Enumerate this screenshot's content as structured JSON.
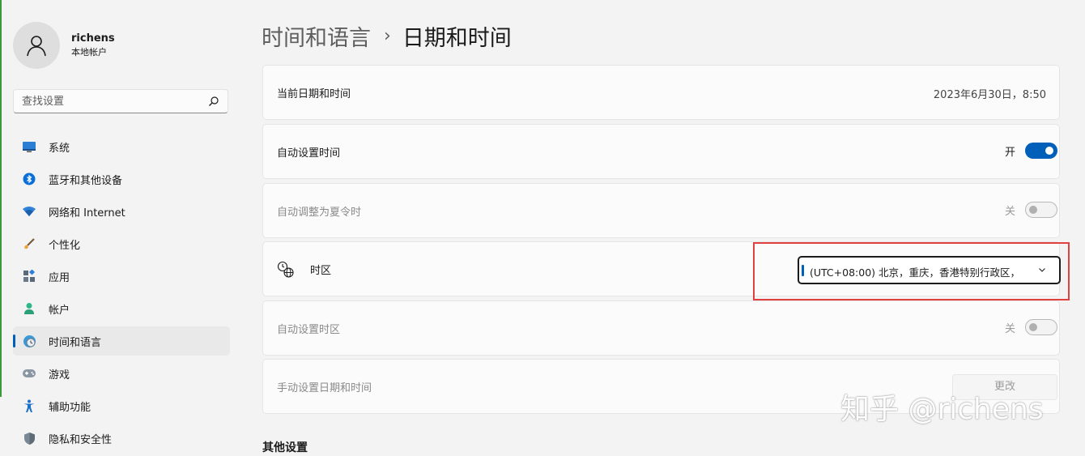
{
  "profile": {
    "name": "richens",
    "account_type": "本地帐户"
  },
  "search": {
    "placeholder": "查找设置"
  },
  "nav": {
    "items": [
      {
        "label": "系统",
        "icon": "monitor-icon"
      },
      {
        "label": "蓝牙和其他设备",
        "icon": "bluetooth-icon"
      },
      {
        "label": "网络和 Internet",
        "icon": "wifi-icon"
      },
      {
        "label": "个性化",
        "icon": "brush-icon"
      },
      {
        "label": "应用",
        "icon": "apps-icon"
      },
      {
        "label": "帐户",
        "icon": "account-icon"
      },
      {
        "label": "时间和语言",
        "icon": "globe-clock-icon",
        "selected": true
      },
      {
        "label": "游戏",
        "icon": "gamepad-icon"
      },
      {
        "label": "辅助功能",
        "icon": "accessibility-icon"
      },
      {
        "label": "隐私和安全性",
        "icon": "shield-icon"
      }
    ]
  },
  "breadcrumb": {
    "parent": "时间和语言",
    "separator": "›",
    "current": "日期和时间"
  },
  "settings": {
    "current_datetime": {
      "label": "当前日期和时间",
      "value": "2023年6月30日，8:50"
    },
    "auto_time": {
      "label": "自动设置时间",
      "state_label": "开",
      "on": true
    },
    "auto_dst": {
      "label": "自动调整为夏令时",
      "state_label": "关",
      "on": false,
      "disabled": true
    },
    "timezone": {
      "label": "时区",
      "value": "(UTC+08:00) 北京，重庆，香港特别行政区，"
    },
    "auto_timezone": {
      "label": "自动设置时区",
      "state_label": "关",
      "on": false,
      "disabled": true
    },
    "manual": {
      "label": "手动设置日期和时间",
      "button_label": "更改",
      "disabled": true
    }
  },
  "other_settings_title": "其他设置",
  "watermark": "知乎 @richens",
  "colors": {
    "accent": "#005fb8",
    "highlight_box": "#e04040",
    "background": "#f3f3f3",
    "card": "#fbfbfb"
  }
}
